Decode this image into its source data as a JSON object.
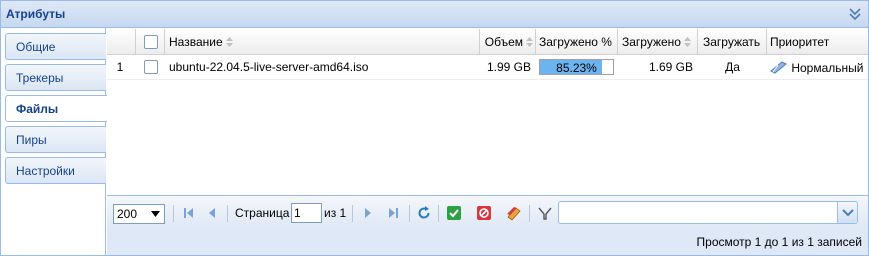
{
  "panel": {
    "title": "Атрибуты"
  },
  "tabs": [
    {
      "label": "Общие",
      "active": false
    },
    {
      "label": "Трекеры",
      "active": false
    },
    {
      "label": "Файлы",
      "active": true
    },
    {
      "label": "Пиры",
      "active": false
    },
    {
      "label": "Настройки",
      "active": false
    }
  ],
  "grid": {
    "columns": {
      "name": "Название",
      "size": "Объем",
      "done_pct": "Загружено %",
      "downloaded": "Загружено",
      "download": "Загружать",
      "priority": "Приоритет"
    },
    "rows": [
      {
        "num": "1",
        "name": "ubuntu-22.04.5-live-server-amd64.iso",
        "size": "1.99 GB",
        "progress_text": "85.23%",
        "progress": 0.8523,
        "downloaded": "1.69 GB",
        "download": "Да",
        "priority": "Нормальный"
      }
    ]
  },
  "pager": {
    "page_size": "200",
    "page_label": "Страница",
    "page_value": "1",
    "of_label": "из 1",
    "filter_value": "",
    "status": "Просмотр 1 до 1 из 1 записей"
  },
  "colors": {
    "accent": "#99bbe8",
    "progress": "#6cb4f0",
    "title": "#15428b"
  }
}
